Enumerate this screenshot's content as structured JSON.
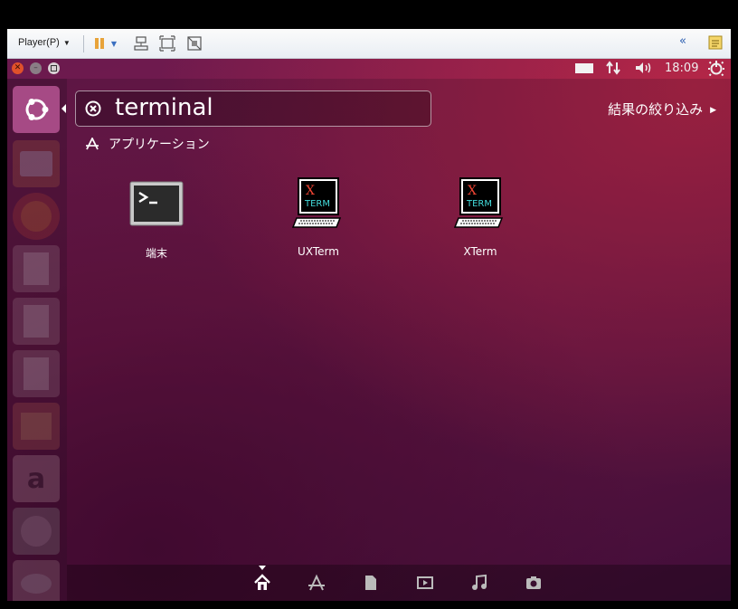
{
  "vm_toolbar": {
    "player_menu_label": "Player(P)",
    "pause_color": "#e8a33a"
  },
  "top_panel": {
    "time": "18:09"
  },
  "dash": {
    "search": {
      "value": "terminal"
    },
    "filter_label": "結果の絞り込み",
    "section_title": "アプリケーション",
    "apps": [
      {
        "label": "端末",
        "icon": "terminal-icon"
      },
      {
        "label": "UXTerm",
        "icon": "xterm-icon"
      },
      {
        "label": "XTerm",
        "icon": "xterm-icon"
      }
    ],
    "lenses": [
      "home-lens-icon",
      "applications-lens-icon",
      "files-lens-icon",
      "video-lens-icon",
      "music-lens-icon",
      "photos-lens-icon"
    ]
  },
  "launcher": {
    "items": [
      "ubuntu-dash-icon",
      "files-icon",
      "firefox-icon",
      "writer-icon",
      "calc-icon",
      "impress-icon",
      "software-center-icon",
      "amazon-icon",
      "settings-icon",
      "system-icon"
    ]
  },
  "colors": {
    "accent": "#dd4814",
    "wallpaper": "#7b1b4c"
  }
}
